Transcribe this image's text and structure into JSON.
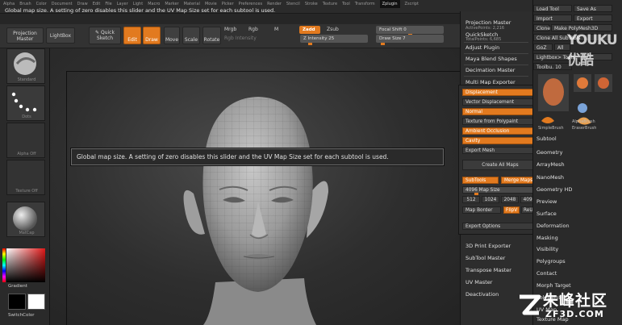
{
  "menu": [
    "Alpha",
    "Brush",
    "Color",
    "Document",
    "Draw",
    "Edit",
    "File",
    "Layer",
    "Light",
    "Macro",
    "Marker",
    "Material",
    "Movie",
    "Picker",
    "Preferences",
    "Render",
    "Stencil",
    "Stroke",
    "Texture",
    "Tool",
    "Transform",
    "Zplugin",
    "Zscript"
  ],
  "status_text": "Global map size. A setting of zero disables this slider and the UV Map Size set for each subtool is used.",
  "toolbar": {
    "projection_master": "Projection Master",
    "lightbox": "LightBox",
    "quick_sketch": "Quick Sketch",
    "edit": "Edit",
    "draw": "Draw",
    "move": "Move",
    "scale": "Scale",
    "rotate": "Rotate",
    "mrgb": "Mrgb",
    "rgb": "Rgb",
    "m": "M",
    "rgb_intensity": "Rgb Intensity",
    "zadd": "Zadd",
    "zsub": "Zsub",
    "z_intensity": "Z Intensity 25",
    "focal_shift": "Focal Shift 0",
    "draw_size": "Draw Size 7",
    "active_points": "ActivePoints: 2,216",
    "total_points": "TotalPoints: 6,685"
  },
  "left_shelf": {
    "tile1_label": "Standard",
    "tile2_label": "Dots",
    "tile3_label": "Alpha Off",
    "tile4_label": "Texture Off",
    "tile5_label": "MatCap",
    "gradient_label": "Gradient",
    "switch_color_label": "SwitchColor"
  },
  "tooltip": "Global map size. A setting of zero disables this slider and the UV Map Size set for each subtool is used.",
  "right_panel": {
    "items": [
      "Projection Master",
      "QuickSketch",
      "Adjust Plugin",
      "Maya Blend Shapes",
      "Decimation Master",
      "Multi Map Exporter"
    ],
    "lower_items": [
      "3D Print Exporter",
      "SubTool Master",
      "Transpose Master",
      "UV Master",
      "Deactivation"
    ]
  },
  "mm_panel": {
    "displacement": "Displacement",
    "vector_displacement": "Vector Displacement",
    "normal": "Normal",
    "texture_from_polypaint": "Texture from Polypaint",
    "ambient_occlusion": "Ambient Occlusion",
    "cavity": "Cavity",
    "export_mesh": "Export Mesh",
    "create_all_maps": "Create All Maps",
    "subtools": "SubTools",
    "merge_maps": "Merge Maps",
    "map_size": "4096 Map Size",
    "sizes": [
      "512",
      "1024",
      "2048",
      "4096"
    ],
    "map_border": "Map Border",
    "flipv": "FlipV",
    "revu": "ReUV",
    "export_options": "Export Options"
  },
  "far_right": {
    "load_tool": "Load Tool",
    "save_as": "Save As",
    "import": "Import",
    "export": "Export",
    "clone": "Clone",
    "make_polymesh3d": "Make PolyMesh3D",
    "clone_all_subtools": "Clone All SubTools",
    "goz": "GoZ",
    "all": "All",
    "lightbox_tools": "Lightbox> Tools",
    "tools_count": "Toolbu. 10",
    "brush1": "AlphaBrush",
    "brush2": "EraserBrush",
    "brush3": "SimpleBrush",
    "items": [
      "Subtool",
      "Geometry",
      "ArrayMesh",
      "NanoMesh",
      "Geometry HD",
      "Preview",
      "Surface",
      "Deformation",
      "Masking",
      "Visibility",
      "Polygroups",
      "Contact",
      "Morph Target",
      "Polypaint",
      "UV Map",
      "Texture Map"
    ]
  },
  "watermarks": {
    "youku": "YOUKU 优酷",
    "zf_text": "朱峰社区",
    "zf_url": "ZF3D.COM"
  },
  "colors": {
    "accent": "#e27a1f",
    "bg": "#1b1b1b",
    "panel": "#2d2d2d"
  }
}
